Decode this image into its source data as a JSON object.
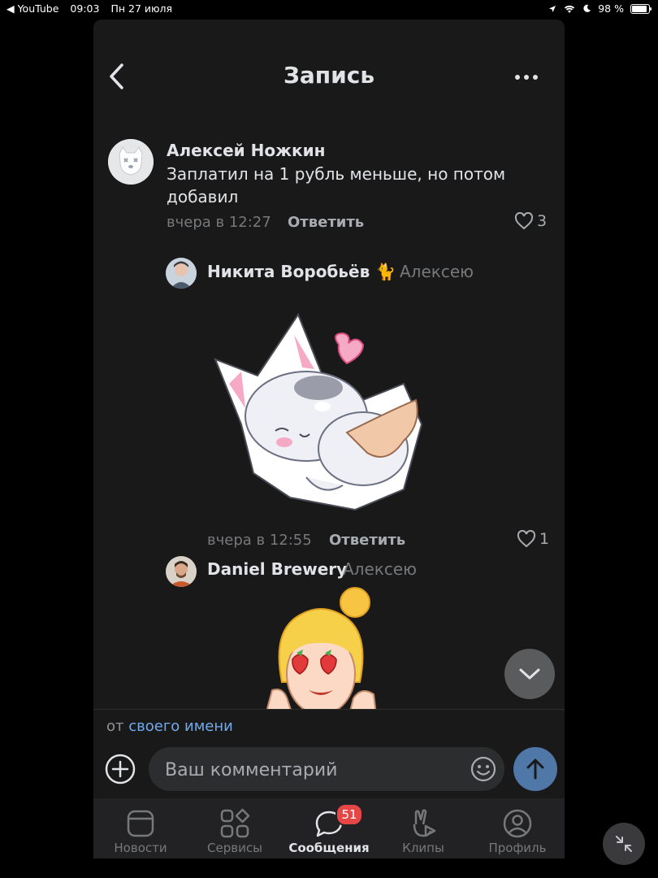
{
  "status_bar": {
    "back_app": "◀ YouTube",
    "time": "09:03",
    "date": "Пн 27 июля",
    "battery": "98 %"
  },
  "header": {
    "title": "Запись"
  },
  "comments": [
    {
      "author": "Алексей Ножкин",
      "text": "Заплатил на 1 рубль меньше, но потом добавил",
      "time": "вчера в 12:27",
      "reply_label": "Ответить",
      "likes": "3"
    },
    {
      "author": "Никита Воробьёв 🐈",
      "reply_to": "Алексею",
      "time": "вчера в 12:55",
      "reply_label": "Ответить",
      "likes": "1"
    },
    {
      "author": "Daniel Brewery",
      "reply_to": "Алексею"
    }
  ],
  "compose": {
    "from_prefix": "от",
    "from_link": "своего имени",
    "placeholder": "Ваш комментарий"
  },
  "tabbar": {
    "tabs": [
      {
        "label": "Новости",
        "icon": "news-icon"
      },
      {
        "label": "Сервисы",
        "icon": "services-icon"
      },
      {
        "label": "Сообщения",
        "icon": "messages-icon",
        "badge": "51",
        "active": true
      },
      {
        "label": "Клипы",
        "icon": "clips-icon"
      },
      {
        "label": "Профиль",
        "icon": "profile-icon"
      }
    ]
  },
  "colors": {
    "background": "#19191a",
    "accent_link": "#71aaeb",
    "send_button": "#4f78a8",
    "badge": "#e64646"
  }
}
